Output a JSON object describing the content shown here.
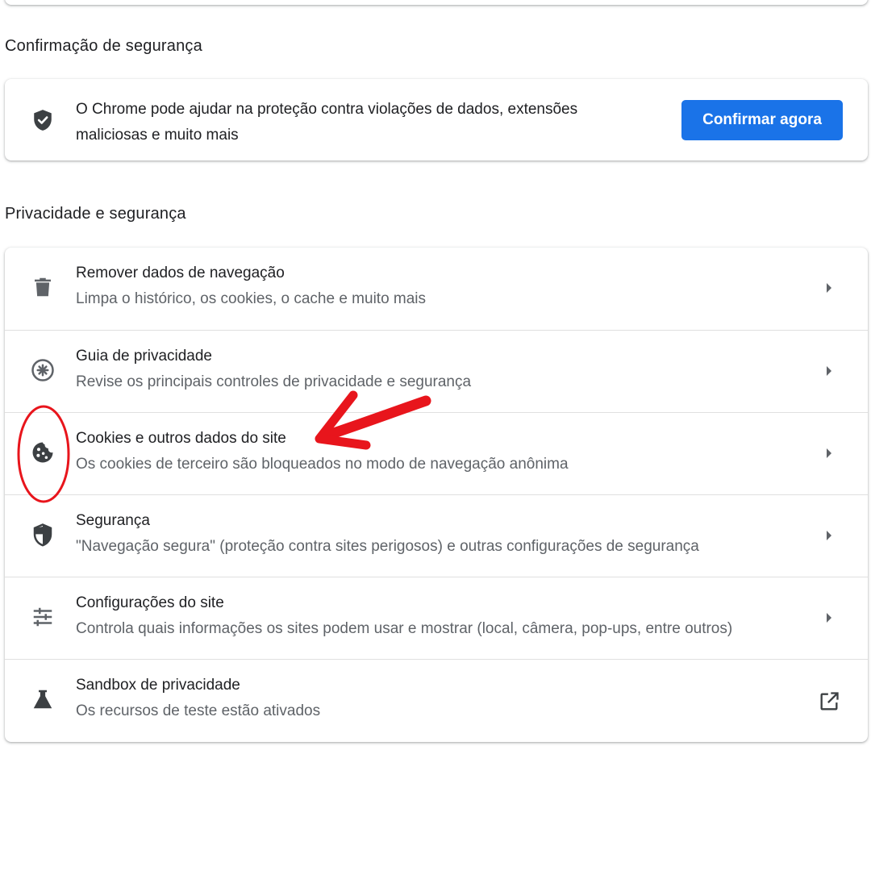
{
  "safety_check": {
    "section_title": "Confirmação de segurança",
    "description_line1": "O Chrome pode ajudar na proteção contra violações de dados, extensões",
    "description_line2": "maliciosas e muito mais",
    "button_label": "Confirmar agora",
    "icon": "shield-check-icon"
  },
  "privacy": {
    "section_title": "Privacidade e segurança",
    "items": [
      {
        "title": "Remover dados de navegação",
        "subtitle": "Limpa o histórico, os cookies, o cache e muito mais",
        "icon": "trash-icon"
      },
      {
        "title": "Guia de privacidade",
        "subtitle": "Revise os principais controles de privacidade e segurança",
        "icon": "compass-icon"
      },
      {
        "title": "Cookies e outros dados do site",
        "subtitle": "Os cookies de terceiro são bloqueados no modo de navegação anônima",
        "icon": "cookie-icon"
      },
      {
        "title": "Segurança",
        "subtitle": "\"Navegação segura\" (proteção contra sites perigosos) e outras configurações de segurança",
        "icon": "shield-icon"
      },
      {
        "title": "Configurações do site",
        "subtitle": "Controla quais informações os sites podem usar e mostrar (local, câmera, pop-ups, entre outros)",
        "icon": "tune-icon"
      },
      {
        "title": "Sandbox de privacidade",
        "subtitle": "Os recursos de teste estão ativados",
        "icon": "flask-icon"
      }
    ]
  },
  "colors": {
    "accent": "#1a73e8",
    "annotation": "#e8151c",
    "icon": "#5f6368",
    "secondary_text": "#5f6368"
  }
}
